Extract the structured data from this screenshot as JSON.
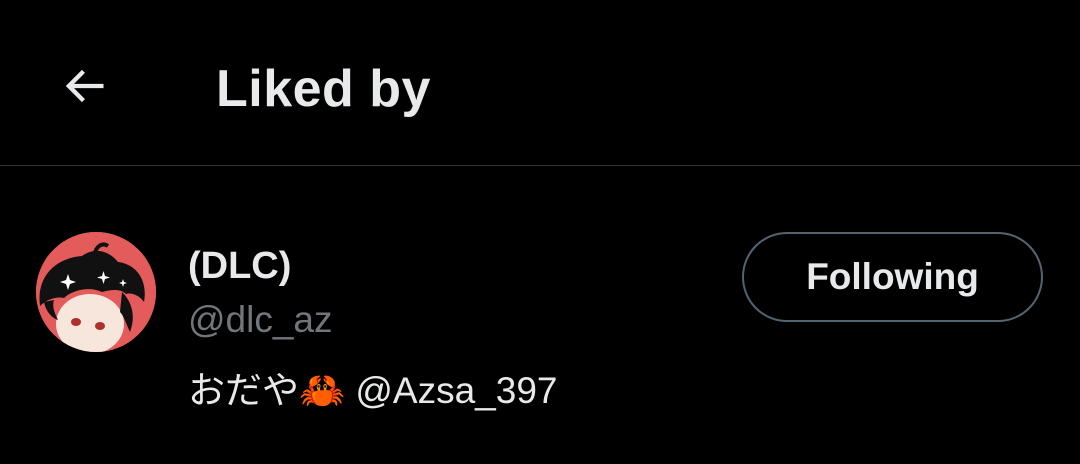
{
  "header": {
    "back_icon": "arrow-left-icon",
    "title": "Liked by"
  },
  "user": {
    "display_name": "(DLC)",
    "handle": "@dlc_az",
    "bio": "おだや🦀 @Azsa_397",
    "follow_button_label": "Following",
    "avatar_color": "#e35b5b"
  },
  "colors": {
    "background": "#000000",
    "primary_text": "#e7e9ea",
    "secondary_text": "#71767b",
    "divider": "#2f3336",
    "button_border": "#536471"
  }
}
